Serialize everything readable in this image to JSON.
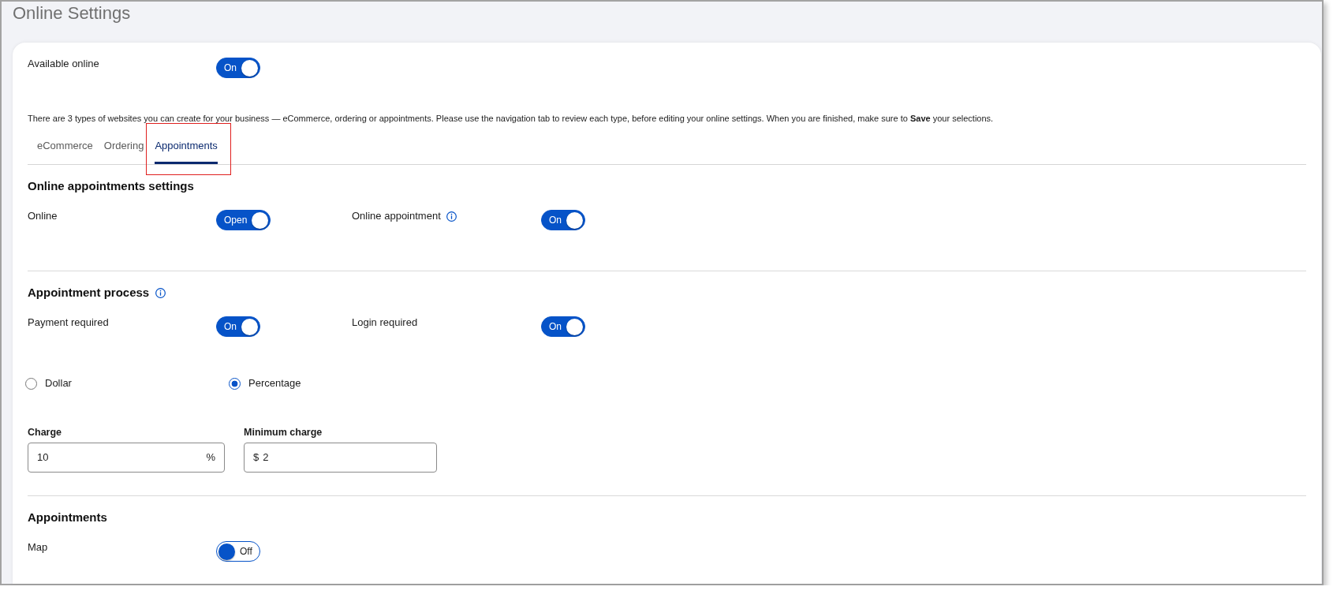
{
  "page": {
    "title": "Online Settings"
  },
  "availability": {
    "kind": "toggles",
    "items": [
      {
        "label": "Available online",
        "info": false,
        "toggle": {
          "on": true,
          "text": "On"
        }
      }
    ]
  },
  "intro": "There are 3 types of websites you can create for your business — eCommerce, ordering or appointments. Please use the navigation tab to review each type, before editing your online settings. When you are finished, make sure to **Save** your selections.",
  "tabs": [
    {
      "label": "eCommerce",
      "selected": false,
      "highlighted": false
    },
    {
      "label": "Ordering",
      "selected": false,
      "highlighted": false
    },
    {
      "label": "Appointments",
      "selected": true,
      "highlighted": true
    }
  ],
  "sections": [
    {
      "title": "Online appointments settings",
      "info": false,
      "rows": [
        {
          "kind": "toggles",
          "items": [
            {
              "label": "Online",
              "info": false,
              "toggle": {
                "on": true,
                "text": "Open"
              }
            },
            {
              "label": "Online appointment",
              "info": true,
              "toggle": {
                "on": true,
                "text": "On"
              }
            }
          ]
        }
      ]
    },
    {
      "title": "Appointment process",
      "info": true,
      "rows": [
        {
          "kind": "toggles",
          "items": [
            {
              "label": "Payment required",
              "info": false,
              "toggle": {
                "on": true,
                "text": "On"
              }
            },
            {
              "label": "Login required",
              "info": false,
              "toggle": {
                "on": true,
                "text": "On"
              }
            }
          ]
        },
        {
          "kind": "radios",
          "options": [
            {
              "label": "Dollar",
              "selected": false
            },
            {
              "label": "Percentage",
              "selected": true
            }
          ]
        },
        {
          "kind": "fields",
          "fields": [
            {
              "label": "Charge",
              "value": "10",
              "suffix": "%"
            },
            {
              "label": "Minimum charge",
              "prefix": "$",
              "value": "2"
            }
          ]
        }
      ]
    },
    {
      "title": "Appointments",
      "info": false,
      "rows": [
        {
          "kind": "toggles",
          "items": [
            {
              "label": "Map",
              "info": false,
              "toggle": {
                "on": false,
                "text": "Off"
              }
            }
          ]
        }
      ]
    }
  ]
}
